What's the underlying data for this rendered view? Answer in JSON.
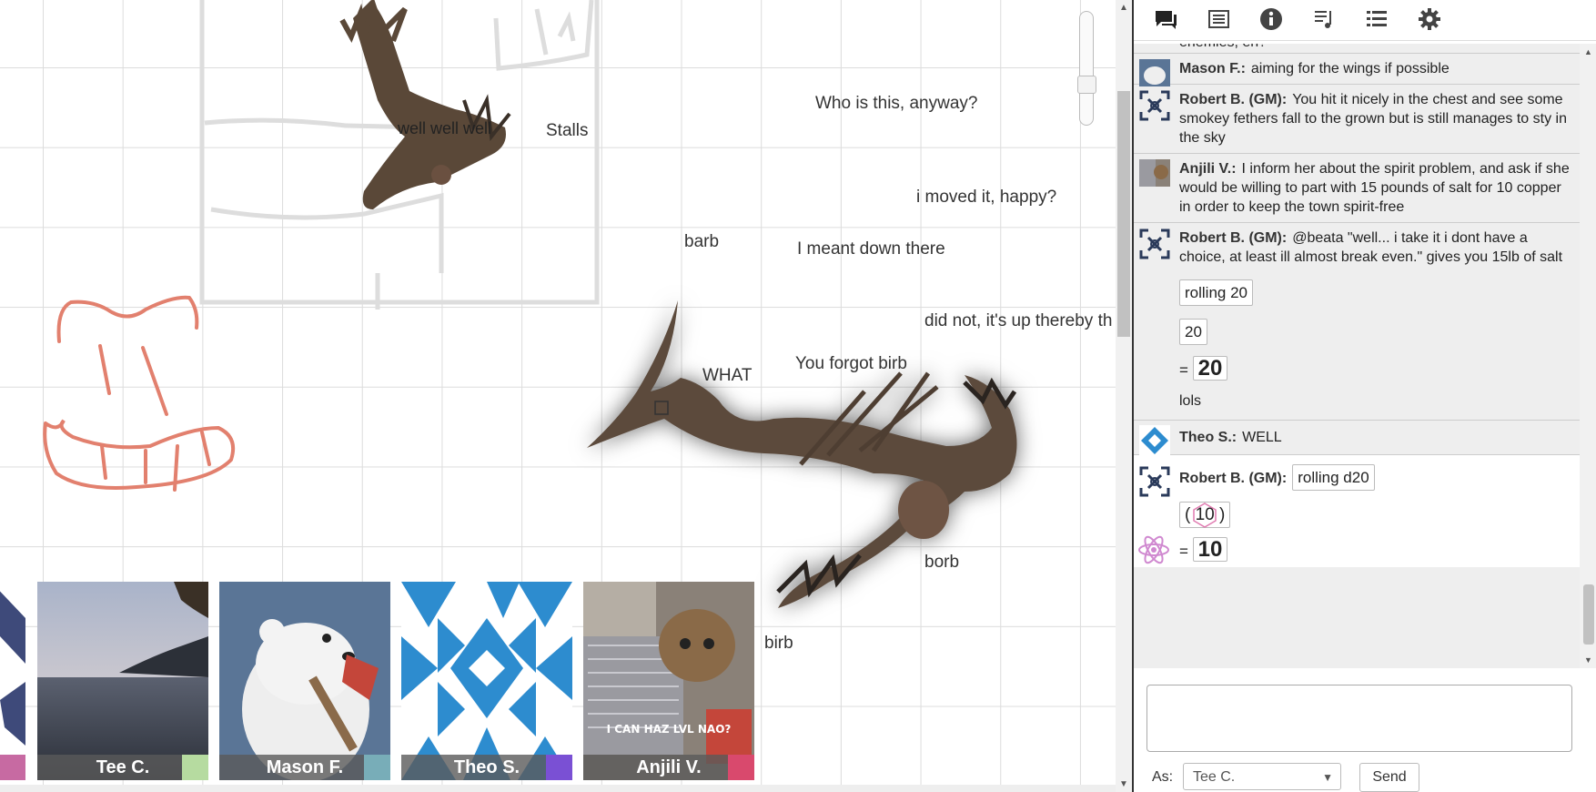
{
  "canvas": {
    "labels": [
      "Who is this, anyway?",
      "well well well",
      "Stalls",
      "i moved it, happy?",
      "barb",
      "I meant down there",
      "did not, it's up thereby th",
      "WHAT",
      "You forgot birb",
      "borb",
      "birb"
    ]
  },
  "players": [
    {
      "name": "Tee C.",
      "color": "#b6dba0"
    },
    {
      "name": "Mason F.",
      "color": "#78adb8"
    },
    {
      "name": "Theo S.",
      "color": "#7a50d4"
    },
    {
      "name": "Anjili V.",
      "color": "#d9496d"
    }
  ],
  "anjili_caption": "I CAN HAZ LVL NAO?",
  "tabs": [
    {
      "icon": "chat-icon"
    },
    {
      "icon": "journal-icon"
    },
    {
      "icon": "info-icon"
    },
    {
      "icon": "jukebox-icon"
    },
    {
      "icon": "list-icon"
    },
    {
      "icon": "gear-icon"
    }
  ],
  "chat": {
    "top_partial": "enemies, eh?",
    "messages": [
      {
        "who": "Mason F.:",
        "text": "aiming for the wings if possible"
      },
      {
        "who": "Robert B. (GM):",
        "text": "You hit it nicely in the chest and see some smokey fethers fall to the grown but is still manages to sty in the sky"
      },
      {
        "who": "Anjili V.:",
        "text": "I inform her about the spirit problem, and ask if she would be willing to part with 15 pounds of salt for 10 copper in order to keep the town spirit-free"
      },
      {
        "who": "Robert B. (GM):",
        "text": "@beata \"well... i take it i dont have a choice, at least ill almost break even.\" gives you 15lb of salt"
      }
    ],
    "roll1": {
      "label": "rolling 20",
      "die": "20",
      "eq": "=",
      "total": "20",
      "note": "lols"
    },
    "theo": {
      "who": "Theo S.:",
      "text": "WELL"
    },
    "roll2": {
      "who": "Robert B. (GM):",
      "label": "rolling d20",
      "open": "(",
      "die": "10",
      "close": ")",
      "eq": "=",
      "total": "10"
    }
  },
  "footer": {
    "as_label": "As:",
    "as_value": "Tee C.",
    "send_label": "Send"
  }
}
